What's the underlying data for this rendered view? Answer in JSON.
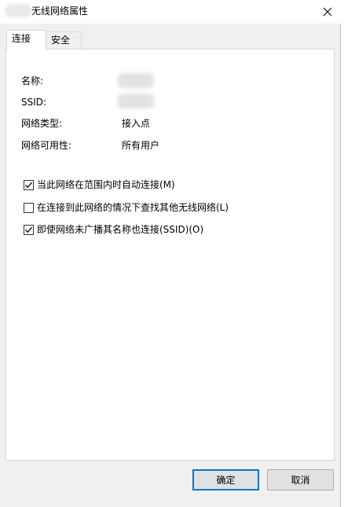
{
  "window": {
    "title": "无线网络属性"
  },
  "tabs": [
    {
      "label": "连接",
      "active": true
    },
    {
      "label": "安全",
      "active": false
    }
  ],
  "properties": {
    "name_label": "名称:",
    "ssid_label": "SSID:",
    "network_type_label": "网络类型:",
    "network_type_value": "接入点",
    "availability_label": "网络可用性:",
    "availability_value": "所有用户"
  },
  "options": [
    {
      "label": "当此网络在范围内时自动连接(M)",
      "checked": true
    },
    {
      "label": "在连接到此网络的情况下查找其他无线网络(L)",
      "checked": false
    },
    {
      "label": "即使网络未广播其名称也连接(SSID)(O)",
      "checked": true
    }
  ],
  "buttons": {
    "ok": "确定",
    "cancel": "取消"
  },
  "colors": {
    "accent": "#0078d7",
    "dialog_bg": "#f0f0f0",
    "panel_bg": "#ffffff"
  },
  "icons": {
    "close": "close-icon",
    "check": "checkmark-icon"
  }
}
